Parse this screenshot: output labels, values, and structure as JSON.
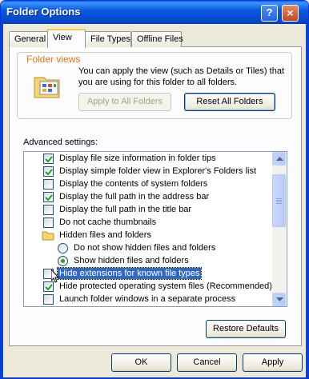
{
  "window": {
    "title": "Folder Options",
    "help_glyph": "?",
    "close_glyph": "×"
  },
  "tabs": [
    {
      "label": "General",
      "active": false
    },
    {
      "label": "View",
      "active": true
    },
    {
      "label": "File Types",
      "active": false
    },
    {
      "label": "Offline Files",
      "active": false
    }
  ],
  "folder_views": {
    "label": "Folder views",
    "description": "You can apply the view (such as Details or Tiles) that you are using for this folder to all folders.",
    "apply_button": "Apply to All Folders",
    "reset_button": "Reset All Folders"
  },
  "advanced": {
    "label": "Advanced settings:",
    "items": [
      {
        "type": "checkbox",
        "checked": true,
        "label": "Display file size information in folder tips"
      },
      {
        "type": "checkbox",
        "checked": true,
        "label": "Display simple folder view in Explorer's Folders list"
      },
      {
        "type": "checkbox",
        "checked": false,
        "label": "Display the contents of system folders"
      },
      {
        "type": "checkbox",
        "checked": true,
        "label": "Display the full path in the address bar"
      },
      {
        "type": "checkbox",
        "checked": false,
        "label": "Display the full path in the title bar"
      },
      {
        "type": "checkbox",
        "checked": false,
        "label": "Do not cache thumbnails"
      },
      {
        "type": "folder",
        "label": "Hidden files and folders"
      },
      {
        "type": "radio",
        "checked": false,
        "label": "Do not show hidden files and folders"
      },
      {
        "type": "radio",
        "checked": true,
        "label": "Show hidden files and folders"
      },
      {
        "type": "checkbox",
        "checked": false,
        "label": "Hide extensions for known file types",
        "selected": true
      },
      {
        "type": "checkbox",
        "checked": true,
        "label": "Hide protected operating system files (Recommended)"
      },
      {
        "type": "checkbox",
        "checked": false,
        "label": "Launch folder windows in a separate process"
      }
    ]
  },
  "restore_button": "Restore Defaults",
  "footer": {
    "ok": "OK",
    "cancel": "Cancel",
    "apply": "Apply"
  },
  "colors": {
    "titlebar": "#0a5ae0",
    "selection": "#316ac5",
    "group_label": "#e6770c",
    "check": "#21a121"
  }
}
